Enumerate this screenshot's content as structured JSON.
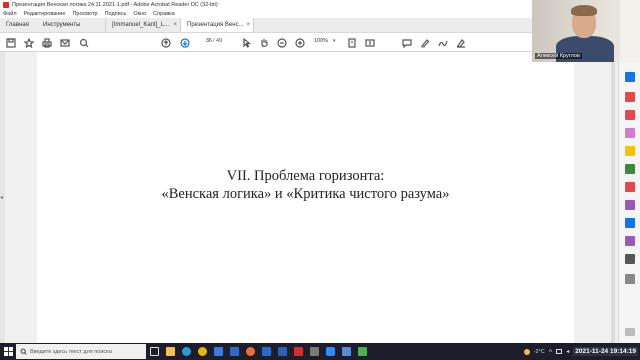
{
  "window": {
    "title": "Презентация Венская логика 24.11.2021-1.pdf - Adobe Acrobat Reader DC (32-bit)"
  },
  "menu": [
    "Файл",
    "Редактирование",
    "Просмотр",
    "Подпись",
    "Окно",
    "Справка"
  ],
  "tabs": [
    {
      "label": "Главная"
    },
    {
      "label": "Инструменты"
    },
    {
      "label": "[Immanuel_Kant]_L...",
      "close": "×"
    },
    {
      "label": "Презентация Венс...",
      "close": "×"
    }
  ],
  "toolbar": {
    "page_current": "36",
    "page_total": "/ 49",
    "zoom": "100%",
    "zoom_caret": "▾"
  },
  "document": {
    "line1": "VII. Проблема горизонта:",
    "line2": "«Венская логика» и «Критика чистого разума»"
  },
  "webcam": {
    "name": "Алексей Круглов"
  },
  "taskbar": {
    "search_placeholder": "Введите здесь текст для поиска",
    "temperature": "-2°C",
    "datetime": "2021-11-24  19:14:19"
  },
  "colors": {
    "accent_blue": "#1473e6",
    "acrobat_red": "#d32f2f",
    "taskbar": "#1d1d2b"
  }
}
